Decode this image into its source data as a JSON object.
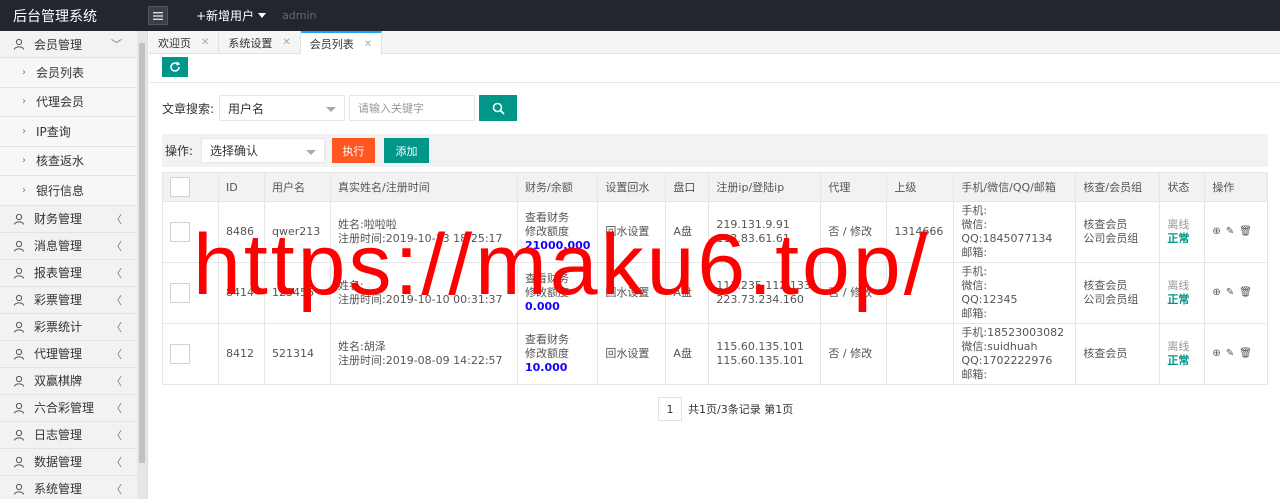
{
  "app": {
    "title": "后台管理系统",
    "add_user": "+新增用户",
    "admin": "admin"
  },
  "sidebar": {
    "items": [
      {
        "label": "会员管理",
        "icon": "user-icon",
        "expanded": true
      },
      {
        "label": "财务管理",
        "icon": "car-icon"
      },
      {
        "label": "消息管理",
        "icon": "message-icon"
      },
      {
        "label": "报表管理",
        "icon": "report-icon"
      },
      {
        "label": "彩票管理",
        "icon": "user-icon"
      },
      {
        "label": "彩票统计",
        "icon": "user-icon"
      },
      {
        "label": "代理管理",
        "icon": "user-icon"
      },
      {
        "label": "双赢棋牌",
        "icon": "user-icon"
      },
      {
        "label": "六合彩管理",
        "icon": "user-icon"
      },
      {
        "label": "日志管理",
        "icon": "user-icon"
      },
      {
        "label": "数据管理",
        "icon": "user-icon"
      },
      {
        "label": "系统管理",
        "icon": "user-icon"
      }
    ],
    "subitems": [
      "会员列表",
      "代理会员",
      "IP查询",
      "核查返水",
      "银行信息"
    ]
  },
  "tabs": [
    {
      "label": "欢迎页"
    },
    {
      "label": "系统设置"
    },
    {
      "label": "会员列表",
      "active": true
    }
  ],
  "search": {
    "label": "文章搜索:",
    "field_value": "用户名",
    "placeholder": "请输入关键字"
  },
  "operation": {
    "label": "操作:",
    "select_value": "选择确认",
    "exec_label": "执行",
    "add_label": "添加"
  },
  "table": {
    "headers": [
      "",
      "ID",
      "用户名",
      "真实姓名/注册时间",
      "财务/余额",
      "设置回水",
      "盘口",
      "注册ip/登陆ip",
      "代理",
      "上级",
      "手机/微信/QQ/邮箱",
      "核查/会员组",
      "状态",
      "操作"
    ],
    "rows": [
      {
        "id": "8486",
        "username": "qwer213",
        "name_line": "姓名:啦啦啦",
        "reg_time": "注册时间:2019-10-13 18:25:17",
        "fin_view": "查看财务",
        "fin_edit": "修改额度",
        "balance": "21000.000",
        "rebate": "回水设置",
        "pan": "A盘",
        "ip1": "219.131.9.91",
        "ip2": "113.83.61.61",
        "agent": "否 / 修改",
        "parent": "1314666",
        "c1": "手机:",
        "c2": "微信:",
        "c3": "QQ:1845077134",
        "c4": "邮箱:",
        "check": "核查会员",
        "group": "公司会员组",
        "status1": "离线",
        "status2": "正常"
      },
      {
        "id": "8414",
        "username": "123456",
        "name_line": "姓名:",
        "reg_time": "注册时间:2019-10-10 00:31:37",
        "fin_view": "查看财务",
        "fin_edit": "修改额度",
        "balance": "0.000",
        "rebate": "回水设置",
        "pan": "A盘",
        "ip1": "113.235.112.133",
        "ip2": "223.73.234.160",
        "agent": "否 / 修改",
        "parent": "",
        "c1": "手机:",
        "c2": "微信:",
        "c3": "QQ:12345",
        "c4": "邮箱:",
        "check": "核查会员",
        "group": "公司会员组",
        "status1": "离线",
        "status2": "正常"
      },
      {
        "id": "8412",
        "username": "521314",
        "name_line": "姓名:胡泽",
        "reg_time": "注册时间:2019-08-09 14:22:57",
        "fin_view": "查看财务",
        "fin_edit": "修改额度",
        "balance": "10.000",
        "rebate": "回水设置",
        "pan": "A盘",
        "ip1": "115.60.135.101",
        "ip2": "115.60.135.101",
        "agent": "否 / 修改",
        "parent": "",
        "c1": "手机:18523003082",
        "c2": "微信:suidhuah",
        "c3": "QQ:1702222976",
        "c4": "邮箱:",
        "check": "核查会员",
        "group": "",
        "status1": "离线",
        "status2": "正常"
      }
    ]
  },
  "pager": {
    "page": "1",
    "summary": "共1页/3条记录 第1页"
  },
  "watermark": "https://maku6.top/",
  "colors": {
    "accent": "#009688",
    "danger": "#ff5722",
    "topbar": "#23262e",
    "balance": "#1400ff",
    "watermark": "#ff0000"
  }
}
